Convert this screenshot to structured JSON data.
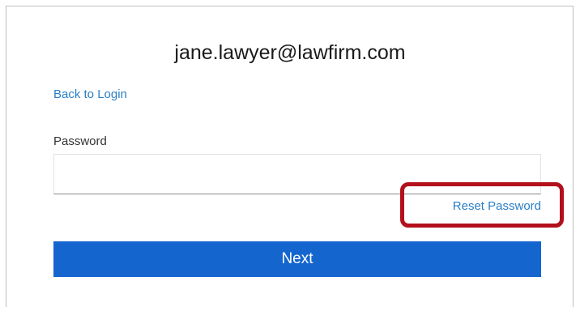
{
  "login": {
    "email": "jane.lawyer@lawfirm.com",
    "back_link": "Back to Login",
    "password_label": "Password",
    "password_value": "",
    "reset_link": "Reset Password",
    "next_label": "Next"
  },
  "colors": {
    "link": "#2a7ec4",
    "primary_button": "#1565cf",
    "highlight": "#b3101c"
  }
}
